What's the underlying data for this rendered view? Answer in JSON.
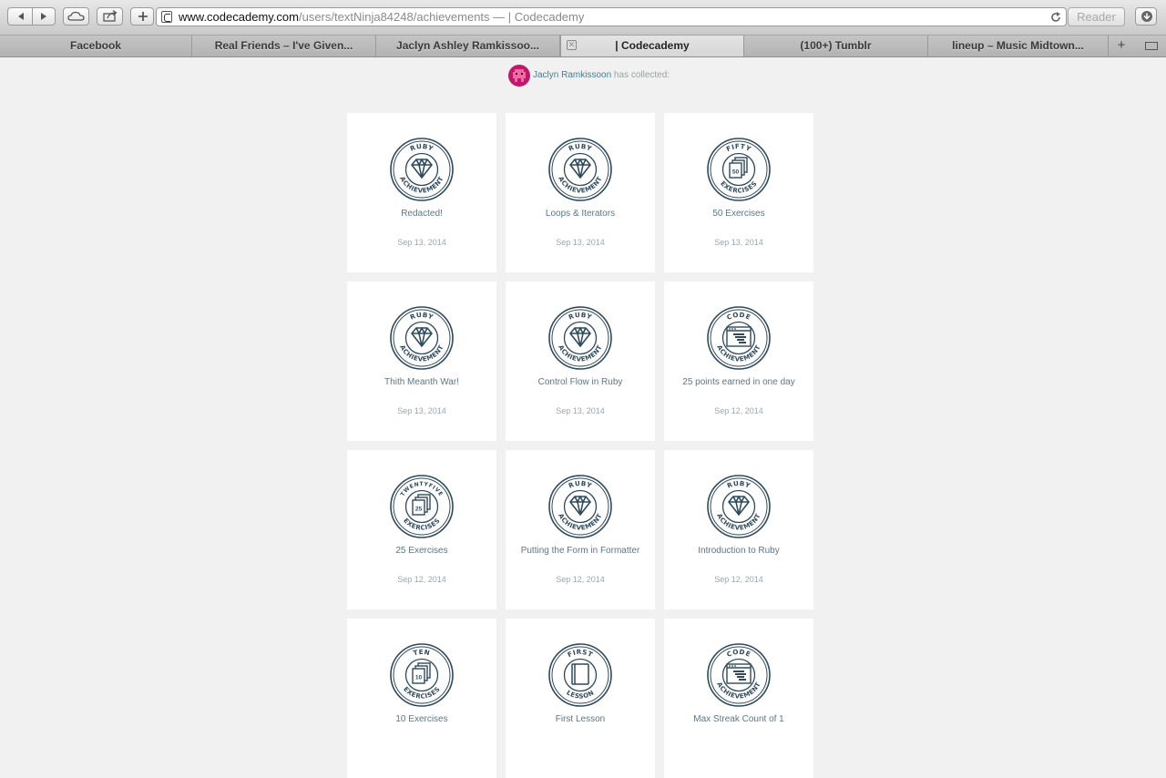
{
  "browser": {
    "url_host": "www.codecademy.com",
    "url_path": "/users/textNinja84248/achievements",
    "url_title": " — | Codecademy",
    "reader_label": "Reader",
    "tabs": [
      {
        "label": "Facebook",
        "active": false
      },
      {
        "label": "Real Friends – I've Given...",
        "active": false
      },
      {
        "label": "Jaclyn Ashley Ramkissoo...",
        "active": false
      },
      {
        "label": "| Codecademy",
        "active": true
      },
      {
        "label": "(100+) Tumblr",
        "active": false
      },
      {
        "label": "lineup – Music Midtown...",
        "active": false
      }
    ]
  },
  "header": {
    "user_name": "Jaclyn Ramkissoon",
    "collected_text": " has collected:"
  },
  "colors": {
    "badge": "#2f4a5c",
    "avatar": "#c2186b",
    "page_background": "#f0f1f0"
  },
  "achievements": [
    {
      "title": "Redacted!",
      "date": "Sep 13, 2014",
      "badge_top": "RUBY",
      "badge_bottom": "ACHIEVEMENT",
      "icon": "gem-icon"
    },
    {
      "title": "Loops & Iterators",
      "date": "Sep 13, 2014",
      "badge_top": "RUBY",
      "badge_bottom": "ACHIEVEMENT",
      "icon": "gem-icon"
    },
    {
      "title": "50 Exercises",
      "date": "Sep 13, 2014",
      "badge_top": "FIFTY",
      "badge_bottom": "EXERCISES",
      "icon": "pages-icon",
      "icon_number": "50"
    },
    {
      "title": "Thith Meanth War!",
      "date": "Sep 13, 2014",
      "badge_top": "RUBY",
      "badge_bottom": "ACHIEVEMENT",
      "icon": "gem-icon"
    },
    {
      "title": "Control Flow in Ruby",
      "date": "Sep 13, 2014",
      "badge_top": "RUBY",
      "badge_bottom": "ACHIEVEMENT",
      "icon": "gem-icon"
    },
    {
      "title": "25 points earned in one day",
      "date": "Sep 12, 2014",
      "badge_top": "CODE",
      "badge_bottom": "ACHIEVEMENT",
      "icon": "code-window-icon"
    },
    {
      "title": "25 Exercises",
      "date": "Sep 12, 2014",
      "badge_top": "TWENTYFIVE",
      "badge_bottom": "EXERCISES",
      "icon": "pages-icon",
      "icon_number": "25"
    },
    {
      "title": "Putting the Form in Formatter",
      "date": "Sep 12, 2014",
      "badge_top": "RUBY",
      "badge_bottom": "ACHIEVEMENT",
      "icon": "gem-icon"
    },
    {
      "title": "Introduction to Ruby",
      "date": "Sep 12, 2014",
      "badge_top": "RUBY",
      "badge_bottom": "ACHIEVEMENT",
      "icon": "gem-icon"
    },
    {
      "title": "10 Exercises",
      "date": "",
      "badge_top": "TEN",
      "badge_bottom": "EXERCISES",
      "icon": "pages-icon",
      "icon_number": "10"
    },
    {
      "title": "First Lesson",
      "date": "",
      "badge_top": "FIRST",
      "badge_bottom": "LESSON",
      "icon": "book-icon"
    },
    {
      "title": "Max Streak Count of 1",
      "date": "",
      "badge_top": "CODE",
      "badge_bottom": "ACHIEVEMENT",
      "icon": "code-window-icon"
    }
  ]
}
